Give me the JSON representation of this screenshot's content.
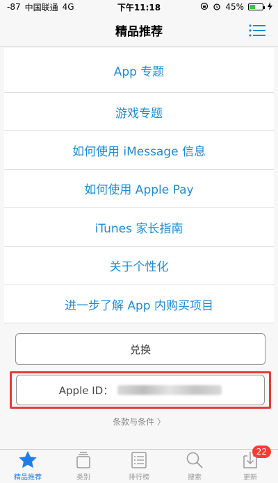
{
  "status_bar": {
    "signal": "-87",
    "carrier": "中国联通",
    "network": "4G",
    "time": "下午11:18",
    "battery_text": "45%",
    "battery_level": 0.45,
    "battery_color": "#2fce3a"
  },
  "nav": {
    "title": "精品推荐",
    "menu_icon": "list-icon"
  },
  "links": [
    "App 专题",
    "游戏专题",
    "如何使用 iMessage 信息",
    "如何使用 Apple Pay",
    "iTunes 家长指南",
    "关于个性化",
    "进一步了解 App 内购买项目"
  ],
  "redeem_label": "兑换",
  "apple_id_label": "Apple ID：",
  "terms_label": "条款与条件 〉",
  "tabs": [
    {
      "label": "精品推荐",
      "icon": "star-icon",
      "active": true
    },
    {
      "label": "类别",
      "icon": "categories-icon",
      "active": false
    },
    {
      "label": "排行榜",
      "icon": "list-rank-icon",
      "active": false
    },
    {
      "label": "搜索",
      "icon": "search-icon",
      "active": false
    },
    {
      "label": "更新",
      "icon": "download-icon",
      "active": false,
      "badge": "22"
    }
  ],
  "colors": {
    "link": "#1e8ad0",
    "highlight_border": "#e23b3b",
    "tab_active": "#1e7ee8",
    "badge": "#ff3b30"
  }
}
